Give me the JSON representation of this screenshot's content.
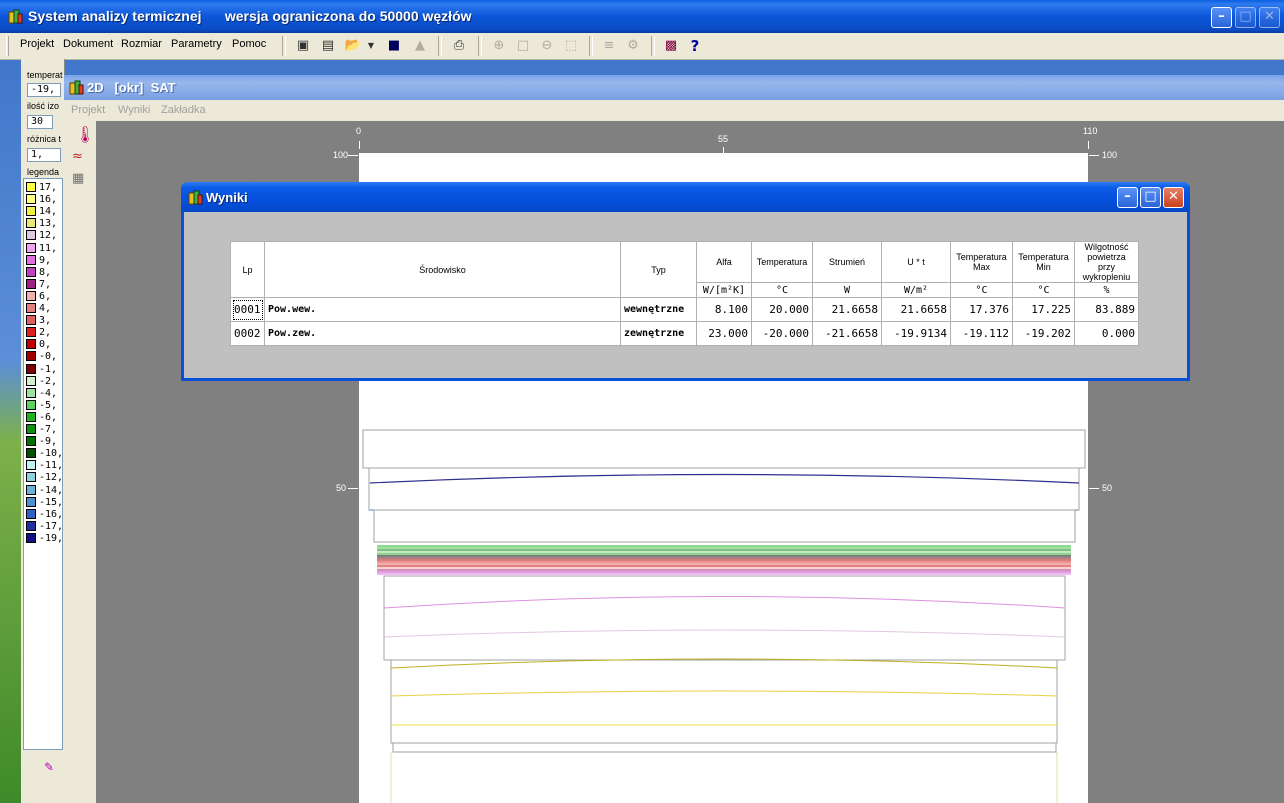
{
  "main_window": {
    "title": "System analizy termicznej",
    "subtitle": "wersja ograniczona do 50000 węzłów"
  },
  "menu": [
    "Projekt",
    "Dokument",
    "Rozmiar",
    "Parametry",
    "Pomoc"
  ],
  "left_panel": {
    "temperature_label": "temperat",
    "temperature_value": "-19,",
    "isotherm_label": "ilość izo",
    "isotherm_value": "30",
    "diff_label": "różnica t",
    "diff_value": "1,",
    "legend_label": "legenda",
    "legend": [
      {
        "label": "17,",
        "color": "#ffff40"
      },
      {
        "label": "16,",
        "color": "#ffff80"
      },
      {
        "label": "14,",
        "color": "#f0f040"
      },
      {
        "label": "13,",
        "color": "#e8e878"
      },
      {
        "label": "12,",
        "color": "#e0c8e0"
      },
      {
        "label": "11,",
        "color": "#f0a0f0"
      },
      {
        "label": "9,",
        "color": "#e070e0"
      },
      {
        "label": "8,",
        "color": "#c040c0"
      },
      {
        "label": "7,",
        "color": "#a02080"
      },
      {
        "label": "6,",
        "color": "#f0b0b0"
      },
      {
        "label": "4,",
        "color": "#e08080"
      },
      {
        "label": "3,",
        "color": "#e06060"
      },
      {
        "label": "2,",
        "color": "#e02020"
      },
      {
        "label": "0,",
        "color": "#c00000"
      },
      {
        "label": "-0,",
        "color": "#a00000"
      },
      {
        "label": "-1,",
        "color": "#800000"
      },
      {
        "label": "-2,",
        "color": "#d0f0d0"
      },
      {
        "label": "-4,",
        "color": "#a0e0a0"
      },
      {
        "label": "-5,",
        "color": "#60d060"
      },
      {
        "label": "-6,",
        "color": "#20b020"
      },
      {
        "label": "-7,",
        "color": "#109010"
      },
      {
        "label": "-9,",
        "color": "#007000"
      },
      {
        "label": "-10,",
        "color": "#005000"
      },
      {
        "label": "-11,",
        "color": "#c0f0f0"
      },
      {
        "label": "-12,",
        "color": "#90d0e0"
      },
      {
        "label": "-14,",
        "color": "#70b0d8"
      },
      {
        "label": "-15,",
        "color": "#5090d0"
      },
      {
        "label": "-16,",
        "color": "#3060c0"
      },
      {
        "label": "-17,",
        "color": "#2030a0"
      },
      {
        "label": "-19,",
        "color": "#101080"
      }
    ]
  },
  "child_window": {
    "title": "2D   [okr]  SAT",
    "menu": [
      "Projekt",
      "Wyniki",
      "Zakładka"
    ]
  },
  "rulers": {
    "top": [
      "0",
      "55",
      "110"
    ],
    "side": [
      "100",
      "50"
    ]
  },
  "dialog": {
    "title": "Wyniki",
    "headers": {
      "lp": "Lp",
      "env": "Środowisko",
      "type": "Typ",
      "alfa": "Alfa",
      "temp": "Temperatura",
      "flux": "Strumień",
      "ut": "U * t",
      "tmax": "Temperatura Max",
      "tmin": "Temperatura Min",
      "hum": "Wilgotność powietrza przy wykropleniu"
    },
    "units": {
      "alfa": "W/[m²K]",
      "temp": "°C",
      "flux": "W",
      "ut": "W/m²",
      "tmax": "°C",
      "tmin": "°C",
      "hum": "%"
    },
    "rows": [
      {
        "lp": "0001",
        "env": "Pow.wew.",
        "type": "wewnętrzne",
        "alfa": "8.100",
        "temp": "20.000",
        "flux": "21.6658",
        "ut": "21.6658",
        "tmax": "17.376",
        "tmin": "17.225",
        "hum": "83.889"
      },
      {
        "lp": "0002",
        "env": "Pow.zew.",
        "type": "zewnętrzne",
        "alfa": "23.000",
        "temp": "-20.000",
        "flux": "-21.6658",
        "ut": "-19.9134",
        "tmax": "-19.112",
        "tmin": "-19.202",
        "hum": "0.000"
      }
    ]
  }
}
